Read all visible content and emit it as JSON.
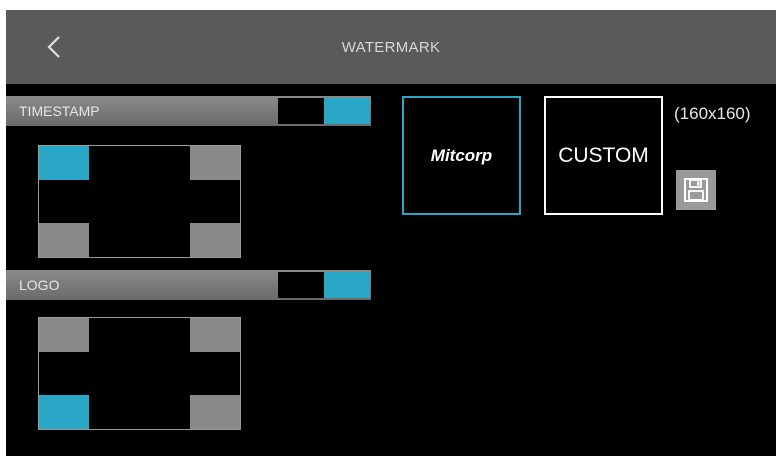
{
  "header": {
    "title": "WATERMARK",
    "back_icon": "chevron-left-icon"
  },
  "timestamp": {
    "label": "TIMESTAMP",
    "enabled": true,
    "selected_position": "top-left"
  },
  "logo": {
    "label": "LOGO",
    "enabled": true,
    "selected_position": "bottom-left"
  },
  "watermark_options": {
    "logo_text": "Mitcorp",
    "selected": "logo",
    "custom_label": "CUSTOM",
    "custom_size": "(160x160)",
    "save_icon": "floppy-disk-icon"
  },
  "colors": {
    "accent": "#2aa6c6",
    "header_bg": "#5a5a5a",
    "inactive_corner": "#8a8a8a",
    "background": "#000000"
  }
}
